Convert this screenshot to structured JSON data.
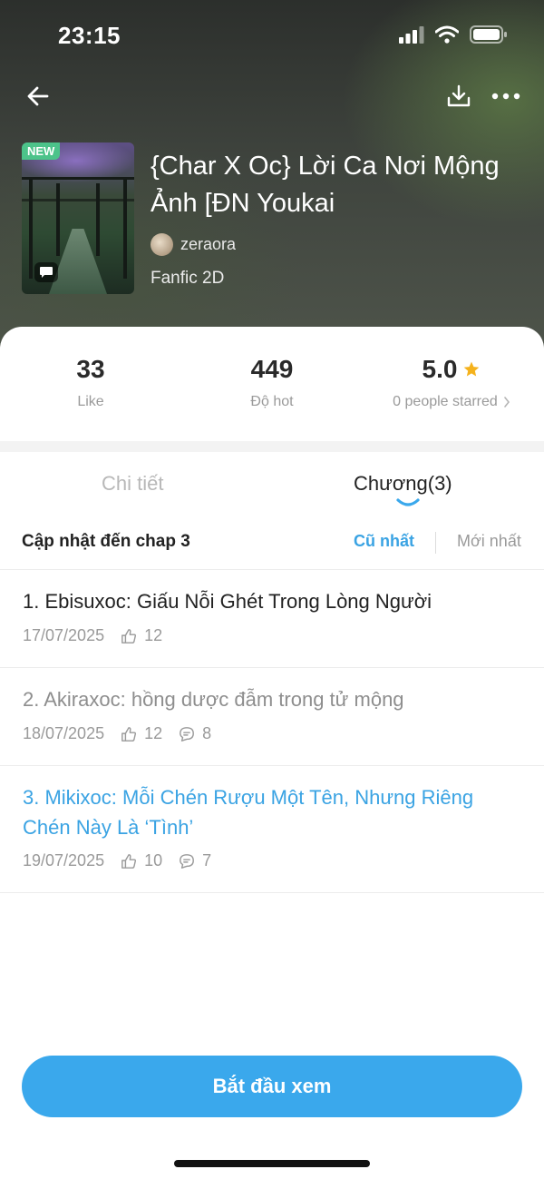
{
  "status_bar": {
    "time": "23:15"
  },
  "story": {
    "badge": "NEW",
    "title": "{Char X Oc} Lời Ca Nơi Mộng Ảnh [ĐN Youkai",
    "author": "zeraora",
    "genre": "Fanfic 2D"
  },
  "stats": {
    "likes": {
      "value": "33",
      "label": "Like"
    },
    "hot": {
      "value": "449",
      "label": "Độ hot"
    },
    "rating": {
      "value": "5.0",
      "label": "0 people starred"
    }
  },
  "tabs": {
    "detail": "Chi tiết",
    "chapters": "Chương(3)"
  },
  "sort": {
    "update_text": "Cập nhật đến chap 3",
    "oldest": "Cũ nhất",
    "newest": "Mới nhất"
  },
  "chapters": [
    {
      "title": "1. Ebisuxoc: Giấu Nỗi Ghét Trong Lòng Người",
      "date": "17/07/2025",
      "likes": "12",
      "comments": ""
    },
    {
      "title": "2. Akiraxoc: hồng dược đẫm trong tử mộng",
      "date": "18/07/2025",
      "likes": "12",
      "comments": "8"
    },
    {
      "title": "3. Mikixoc: Mỗi Chén Rượu Một Tên, Nhưng Riêng Chén Này Là ‘Tình’",
      "date": "19/07/2025",
      "likes": "10",
      "comments": "7"
    }
  ],
  "start_button": "Bắt đầu xem",
  "colors": {
    "accent": "#3aa8ec",
    "active_sort": "#3aa3e3",
    "new_badge": "#4cc38a",
    "star": "#f5b21c",
    "read_chapter": "#8e8e8e",
    "unread_chapter": "#222222",
    "current_chapter": "#3aa3e3"
  },
  "icons": {
    "back": "back-arrow-icon",
    "download": "download-icon",
    "more": "more-dots-icon",
    "like": "thumbs-up-icon",
    "comment": "comment-icon",
    "star": "star-icon",
    "chevron": "chevron-right-icon"
  }
}
